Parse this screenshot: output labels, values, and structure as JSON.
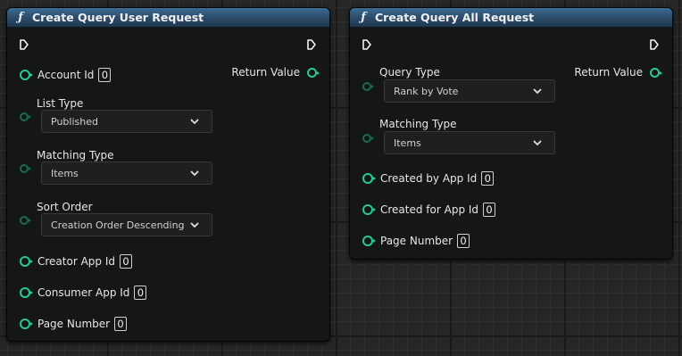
{
  "node_user": {
    "title": "Create Query User Request",
    "fn_icon": "ƒ",
    "return_value": "Return Value",
    "account_id": {
      "label": "Account Id",
      "value": "0"
    },
    "list_type": {
      "label": "List Type",
      "value": "Published"
    },
    "matching_type": {
      "label": "Matching Type",
      "value": "Items"
    },
    "sort_order": {
      "label": "Sort Order",
      "value": "Creation Order Descending"
    },
    "creator_app_id": {
      "label": "Creator App Id",
      "value": "0"
    },
    "consumer_app_id": {
      "label": "Consumer App Id",
      "value": "0"
    },
    "page_number": {
      "label": "Page Number",
      "value": "0"
    }
  },
  "node_all": {
    "title": "Create Query All Request",
    "fn_icon": "ƒ",
    "return_value": "Return Value",
    "query_type": {
      "label": "Query Type",
      "value": "Rank by Vote"
    },
    "matching_type": {
      "label": "Matching Type",
      "value": "Items"
    },
    "created_by_app_id": {
      "label": "Created by App Id",
      "value": "0"
    },
    "created_for_app_id": {
      "label": "Created for App Id",
      "value": "0"
    },
    "page_number": {
      "label": "Page Number",
      "value": "0"
    }
  },
  "colors": {
    "header": "#2f5678",
    "pin_struct": "#29c89a",
    "node_body": "#141714",
    "grid_bg": "#262626"
  },
  "icons": [
    "function-icon",
    "exec-pin-icon",
    "struct-pin-icon",
    "chevron-down-icon"
  ]
}
